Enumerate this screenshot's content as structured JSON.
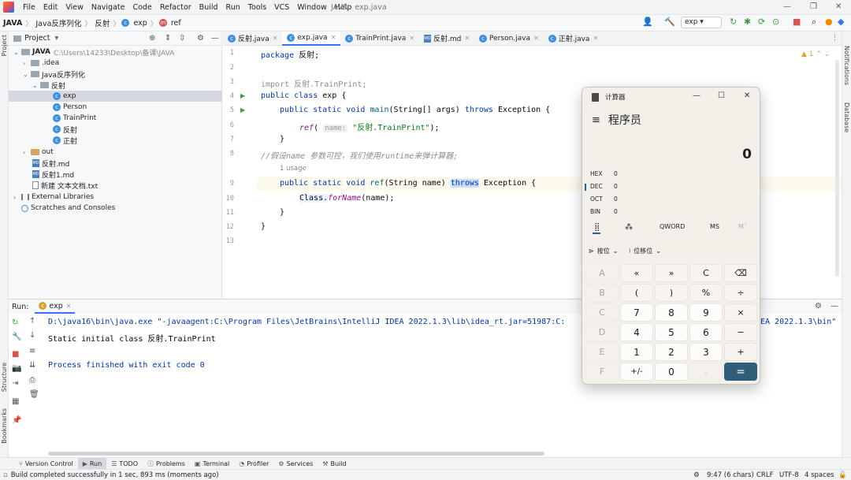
{
  "menubar": {
    "items": [
      "File",
      "Edit",
      "View",
      "Navigate",
      "Code",
      "Refactor",
      "Build",
      "Run",
      "Tools",
      "VCS",
      "Window",
      "Help"
    ],
    "window_title": "JAVA - exp.java"
  },
  "navbar": {
    "crumbs": [
      "JAVA",
      "Java反序列化",
      "反射",
      "exp",
      "ref"
    ],
    "run_config": "exp"
  },
  "stripes": {
    "left": [
      "Project",
      "Structure",
      "Bookmarks"
    ],
    "right": [
      "Notifications",
      "Database"
    ]
  },
  "project": {
    "header": "Project",
    "root_name": "JAVA",
    "root_path": "C:\\Users\\14233\\Desktop\\备课\\JAVA",
    "items": [
      {
        "label": ".idea"
      },
      {
        "label": "Java反序列化"
      },
      {
        "label": "反射"
      },
      {
        "label": "exp"
      },
      {
        "label": "Person"
      },
      {
        "label": "TrainPrint"
      },
      {
        "label": "反射"
      },
      {
        "label": "正射"
      },
      {
        "label": "out"
      },
      {
        "label": "反射.md"
      },
      {
        "label": "反射1.md"
      },
      {
        "label": "新建 文本文档.txt"
      },
      {
        "label": "External Libraries"
      },
      {
        "label": "Scratches and Consoles"
      }
    ]
  },
  "tabs": [
    "反射.java",
    "exp.java",
    "TrainPrint.java",
    "反射.md",
    "Person.java",
    "正射.java"
  ],
  "editor": {
    "line_numbers": [
      "1",
      "2",
      "3",
      "4",
      "5",
      "6",
      "7",
      "8",
      "9",
      "10",
      "11",
      "12",
      "13"
    ],
    "warning_count": "1",
    "usage_hint": "1 usage",
    "param_hint": "name:",
    "l1_kw": "package",
    "l1_rest": " 反射;",
    "l3": "import 反射.TrainPrint;",
    "l4_kw": "public class",
    "l4_rest": " exp {",
    "l5_kw1": "public static void",
    "l5_fn": "main",
    "l5_mid": "(String[] args) ",
    "l5_kw2": "throws",
    "l5_end": " Exception {",
    "l6_fn": "ref",
    "l6_open": "(",
    "l6_str": "\"反射.TrainPrint\"",
    "l6_end": ");",
    "l7": "}",
    "l8": "//假设name 参数可控，我们使用runtime来弹计算器;",
    "l9_kw1": "public static void",
    "l9_fn": "ref",
    "l9_mid": "(String name) ",
    "l9_kw2": "throws",
    "l9_end": " Exception {",
    "l10_cls": "Class.",
    "l10_fn": "forName",
    "l10_end": "(name);",
    "l11": "}",
    "l12": "}"
  },
  "run": {
    "label": "Run:",
    "tab": "exp",
    "cmd_line": "D:\\java16\\bin\\java.exe \"-javaagent:C:\\Program Files\\JetBrains\\IntelliJ IDEA 2022.1.3\\lib\\idea_rt.jar=51987:C:",
    "cmd_tail": "EA 2022.1.3\\bin\"",
    "out_line": "Static initial class 反射.TrainPrint",
    "exit_line": "Process finished with exit code 0"
  },
  "toolwindows": [
    "Version Control",
    "Run",
    "TODO",
    "Problems",
    "Terminal",
    "Profiler",
    "Services",
    "Build"
  ],
  "status": {
    "message": "Build completed successfully in 1 sec, 893 ms (moments ago)",
    "position": "9:47 (6 chars)",
    "line_sep": "CRLF",
    "encoding": "UTF-8",
    "indent": "4 spaces"
  },
  "calculator": {
    "title": "计算器",
    "mode": "程序员",
    "display": "0",
    "radix": [
      {
        "name": "HEX",
        "value": "0"
      },
      {
        "name": "DEC",
        "value": "0"
      },
      {
        "name": "OCT",
        "value": "0"
      },
      {
        "name": "BIN",
        "value": "0"
      }
    ],
    "word_size": "QWORD",
    "ms": "MS",
    "mv": "M˅",
    "bitwise": "按位",
    "bitshift": "位移位",
    "keys": [
      [
        "A",
        "«",
        "»",
        "C",
        "⌫"
      ],
      [
        "B",
        "(",
        ")",
        "%",
        "÷"
      ],
      [
        "C",
        "7",
        "8",
        "9",
        "×"
      ],
      [
        "D",
        "4",
        "5",
        "6",
        "−"
      ],
      [
        "E",
        "1",
        "2",
        "3",
        "+"
      ],
      [
        "F",
        "+/-",
        "0",
        ".",
        "="
      ]
    ]
  }
}
